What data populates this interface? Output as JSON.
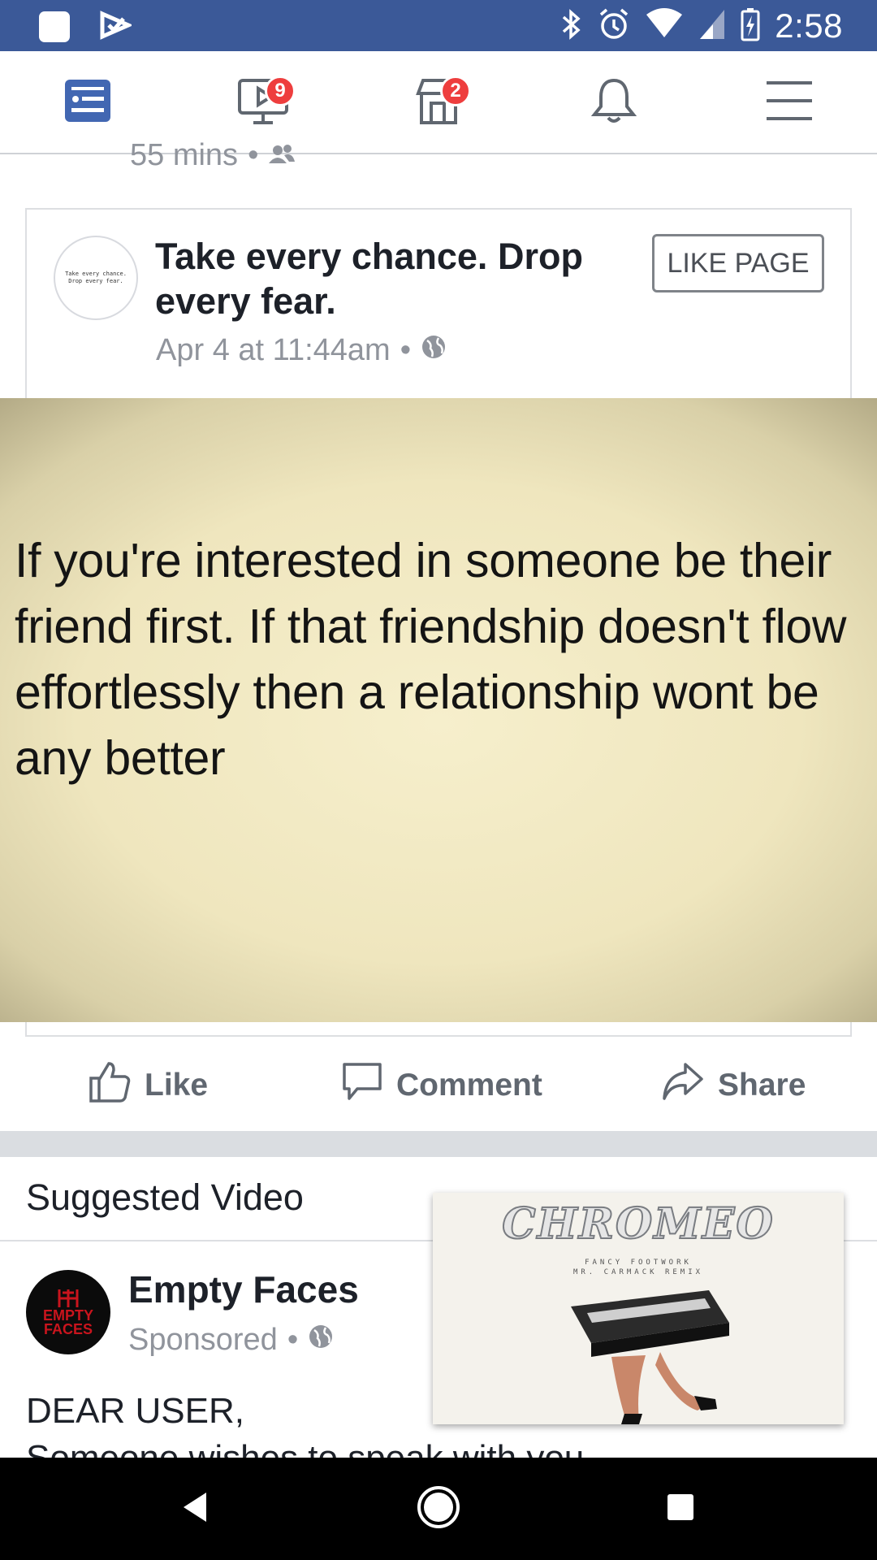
{
  "status_bar": {
    "time": "2:58",
    "icons": [
      "notification-square-icon",
      "check-flag-icon",
      "bluetooth-icon",
      "alarm-icon",
      "wifi-icon",
      "signal-icon",
      "battery-charging-icon"
    ]
  },
  "nav": {
    "items": [
      {
        "name": "news-feed",
        "icon": "news-feed-icon",
        "active": true,
        "badge": ""
      },
      {
        "name": "watch",
        "icon": "video-icon",
        "active": false,
        "badge": "9"
      },
      {
        "name": "marketplace",
        "icon": "marketplace-icon",
        "active": false,
        "badge": "2"
      },
      {
        "name": "notifications",
        "icon": "bell-icon",
        "active": false,
        "badge": ""
      },
      {
        "name": "menu",
        "icon": "menu-icon",
        "active": false,
        "badge": ""
      }
    ],
    "accent": "#4267b2"
  },
  "previous_post": {
    "time": "55 mins",
    "audience_icon": "friends-icon"
  },
  "post": {
    "page_name": "Take every chance. Drop every fear.",
    "avatar_text_line1": "Take every chance.",
    "avatar_text_line2": "Drop every fear.",
    "timestamp": "Apr 4 at 11:44am",
    "audience_icon": "globe-icon",
    "like_page_label": "LIKE PAGE",
    "image_quote": "If you're interested in someone be their friend first. If that friendship doesn't flow effortlessly then a relationship wont be any better"
  },
  "actions": {
    "like": "Like",
    "comment": "Comment",
    "share": "Share"
  },
  "suggested": {
    "header": "Suggested Video",
    "advertiser": "Empty Faces",
    "avatar_text_line1": "EMPTY",
    "avatar_text_line2": "FACES",
    "sponsored": "Sponsored",
    "text_line1": "DEAR USER,",
    "text_line2": "Someone wishes to speak with you",
    "video": {
      "logo": "CHROMEO",
      "subtitle1": "FANCY FOOTWORK",
      "subtitle2": "MR. CARMACK REMIX"
    }
  },
  "system_nav": {
    "icons": [
      "back-icon",
      "home-icon",
      "recents-icon"
    ]
  },
  "colors": {
    "status_bar": "#3b5998",
    "badge": "#ee3e3e",
    "secondary_text": "#90949c"
  }
}
